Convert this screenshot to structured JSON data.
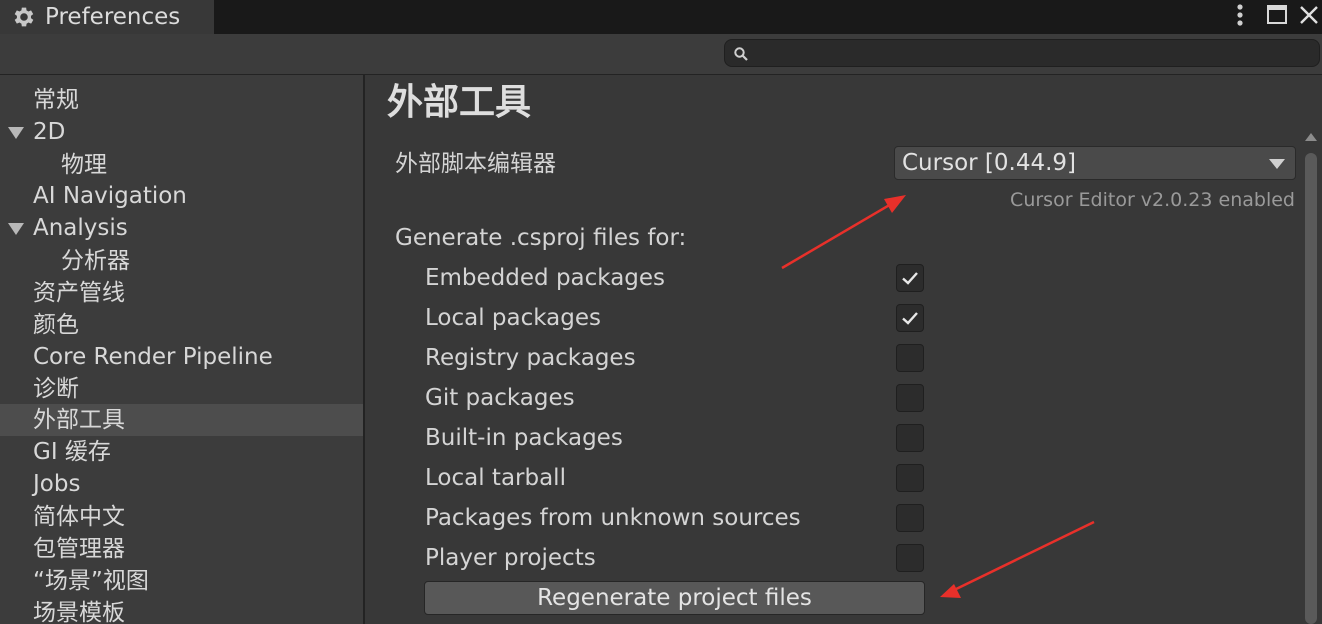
{
  "window": {
    "title": "Preferences",
    "icons": {
      "tab": "gear-icon",
      "menu": "kebab-menu-icon",
      "maximize": "maximize-icon",
      "close": "close-icon"
    }
  },
  "search": {
    "value": "",
    "placeholder": "",
    "icon": "search-icon"
  },
  "sidebar": {
    "items": [
      {
        "label": "常规"
      },
      {
        "label": "2D",
        "expanded": true
      },
      {
        "label": "物理",
        "child": true
      },
      {
        "label": "AI Navigation"
      },
      {
        "label": "Analysis",
        "expanded": true
      },
      {
        "label": "分析器",
        "child": true
      },
      {
        "label": "资产管线"
      },
      {
        "label": "颜色"
      },
      {
        "label": "Core Render Pipeline"
      },
      {
        "label": "诊断"
      },
      {
        "label": "外部工具",
        "selected": true
      },
      {
        "label": "GI 缓存"
      },
      {
        "label": "Jobs"
      },
      {
        "label": "简体中文"
      },
      {
        "label": "包管理器"
      },
      {
        "label": "“场景”视图"
      },
      {
        "label": "场景模板"
      }
    ]
  },
  "main": {
    "title": "外部工具",
    "editor": {
      "label": "外部脚本编辑器",
      "selected": "Cursor [0.44.9]",
      "status": "Cursor Editor v2.0.23 enabled"
    },
    "generate_label": "Generate .csproj files for:",
    "packages": [
      {
        "label": "Embedded packages",
        "checked": true
      },
      {
        "label": "Local packages",
        "checked": true
      },
      {
        "label": "Registry packages",
        "checked": false
      },
      {
        "label": "Git packages",
        "checked": false
      },
      {
        "label": "Built-in packages",
        "checked": false
      },
      {
        "label": "Local tarball",
        "checked": false
      },
      {
        "label": "Packages from unknown sources",
        "checked": false
      },
      {
        "label": "Player projects",
        "checked": false
      }
    ],
    "regenerate_button": "Regenerate project files"
  },
  "colors": {
    "background": "#383838",
    "sidebar": "#3c3c3c",
    "titlebar": "#191919",
    "selected_item": "#4d4d4d",
    "annotation_arrow": "#e8302a"
  }
}
